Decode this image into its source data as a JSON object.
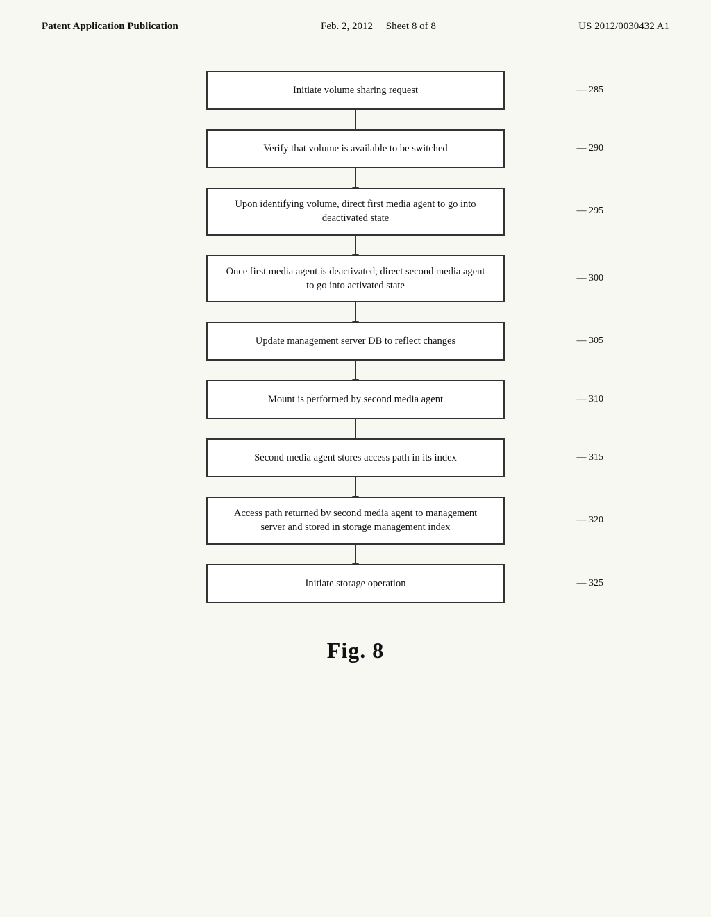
{
  "header": {
    "left": "Patent Application Publication",
    "center": "Feb. 2, 2012",
    "sheet": "Sheet 8 of 8",
    "right": "US 2012/0030432 A1"
  },
  "flowchart": {
    "steps": [
      {
        "id": "step-285",
        "text": "Initiate volume sharing request",
        "ref": "285",
        "multiline": false
      },
      {
        "id": "step-290",
        "text": "Verify that volume is available to be switched",
        "ref": "290",
        "multiline": false
      },
      {
        "id": "step-295",
        "text": "Upon identifying volume, direct first media agent to go into deactivated state",
        "ref": "295",
        "multiline": true
      },
      {
        "id": "step-300",
        "text": "Once first media agent is deactivated, direct second media agent to go into activated state",
        "ref": "300",
        "multiline": true
      },
      {
        "id": "step-305",
        "text": "Update management server DB to reflect changes",
        "ref": "305",
        "multiline": true
      },
      {
        "id": "step-310",
        "text": "Mount is performed by second media agent",
        "ref": "310",
        "multiline": false
      },
      {
        "id": "step-315",
        "text": "Second media agent stores access path in its index",
        "ref": "315",
        "multiline": true
      },
      {
        "id": "step-320",
        "text": "Access path returned by second media agent to management server and stored in storage management index",
        "ref": "320",
        "multiline": true
      },
      {
        "id": "step-325",
        "text": "Initiate storage operation",
        "ref": "325",
        "multiline": false
      }
    ]
  },
  "figure": {
    "label": "Fig. 8"
  }
}
